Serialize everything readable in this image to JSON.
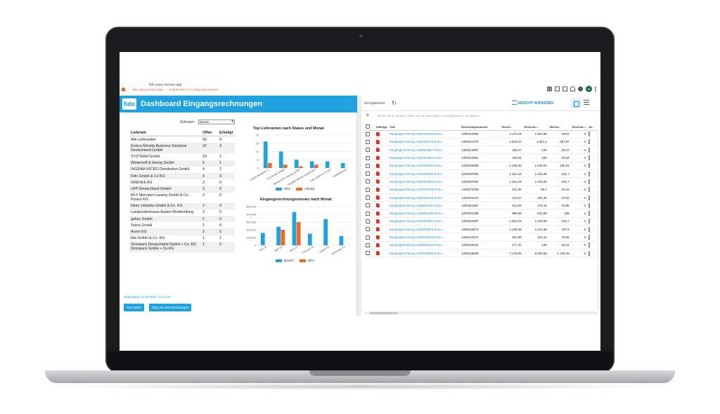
{
  "topbar": {
    "app_name": "fido easy invoice app",
    "breadcrumb": [
      "fido easy invoice app",
      "Ergebnisse in 4 eXtop documents"
    ]
  },
  "dashboard": {
    "logo": "fido",
    "title": "Dashboard Eingangsrechnungen",
    "zeitraum_label": "Zeitraum:",
    "zeitraum_value": "Monat",
    "table_headers": [
      "Lieferant",
      "Offen",
      "Erledigt"
    ],
    "rows": [
      {
        "name": "Alle Lieferanten",
        "offen": "60",
        "erledigt": "9"
      },
      {
        "name": "Konica Minolta Business Solutions Deutschland GmbH",
        "offen": "16",
        "erledigt": "3"
      },
      {
        "name": "SYSTEAM GmbH",
        "offen": "10",
        "erledigt": "2"
      },
      {
        "name": "Winterhoff & Hering GmbH",
        "offen": "5",
        "erledigt": "1"
      },
      {
        "name": "INGRAM MICRO Distribution GmbH",
        "offen": "4",
        "erledigt": "2"
      },
      {
        "name": "Fido GmbH & Co KG",
        "offen": "4",
        "erledigt": "0"
      },
      {
        "name": "GRENKE AG",
        "offen": "3",
        "erledigt": "0"
      },
      {
        "name": "UFP Deutschland GmbH",
        "offen": "3",
        "erledigt": "0"
      },
      {
        "name": "MLF Mercator-Leasing GmbH & Co. Finanz-KG",
        "offen": "3",
        "erledigt": "0"
      },
      {
        "name": "Heinr. Hünicke GmbH & Co. KG",
        "offen": "2",
        "erledigt": "0"
      },
      {
        "name": "Landesoberkasse Baden-Württemberg",
        "offen": "2",
        "erledigt": "0"
      },
      {
        "name": "gebos GmbH",
        "offen": "2",
        "erledigt": "0"
      },
      {
        "name": "Tekno GmbH",
        "offen": "2",
        "erledigt": "0"
      },
      {
        "name": "Auren KG",
        "offen": "2",
        "erledigt": "0"
      },
      {
        "name": "fido GmbH & Co. KG",
        "offen": "1",
        "erledigt": "1"
      },
      {
        "name": "Storopack Deutschland GmbH + Co. KG Storopack GmbH + Co.KG",
        "offen": "1",
        "erledigt": "0"
      }
    ],
    "datenstand": "Datenstand: 22.05.2024, 14:12:24",
    "btn_neu": "Neu laden",
    "btn_alle": "Zeig mir alle Rechnungen"
  },
  "chart_data": [
    {
      "type": "bar",
      "title": "Top Lieferanten nach Status und Monat",
      "categories": [
        "Konica Minolta Business S.",
        "SYSTEAM GmbH",
        "Winterhoff & Hering GmbH",
        "INGRAM MICRO Distribution",
        "Fido GmbH & Co KG",
        "GRENKE AG"
      ],
      "series": [
        {
          "name": "offen",
          "values": [
            16,
            10,
            5,
            4,
            4,
            3
          ],
          "color": "#1ea2e0"
        },
        {
          "name": "erledigt",
          "values": [
            3,
            2,
            1,
            2,
            0,
            0
          ],
          "color": "#f26a21"
        }
      ],
      "yticks": [
        "0",
        "5",
        "10",
        "15",
        "20"
      ],
      "ylim": [
        0,
        20
      ],
      "legend": "bottom"
    },
    {
      "type": "bar",
      "title": "Eingangsrechnungsumsatz nach Monat",
      "categories": [
        "Mai 24",
        "April 24",
        "März 24",
        "Februar 24",
        "Januar 24",
        "Dezember 23"
      ],
      "series": [
        {
          "name": "gesamt",
          "values": [
            160000,
            240000,
            430000,
            150000,
            340000,
            120000
          ],
          "color": "#1ea2e0"
        },
        {
          "name": "offen",
          "values": [
            0,
            200000,
            300000,
            0,
            0,
            0
          ],
          "color": "#f26a21"
        }
      ],
      "yticks": [
        "0",
        "100.000",
        "200.000",
        "300.000",
        "400.000",
        "500.000"
      ],
      "ylim": [
        0,
        500000
      ],
      "legend": "bottom"
    }
  ],
  "results": {
    "count_label": "16 Ergebnisse",
    "ansicht_label": "ANSICHT ANPASSEN",
    "group_hint": "Ziehen Sie die Spalten hierher, um die angezeigten Suchergebnisse zu gruppieren.",
    "headers": [
      "Dateityp",
      "Titel",
      "Rechnungsnummer",
      "Rechn...",
      "Rechnun...",
      "Mehrw...",
      "Rechnun...",
      "Ak..."
    ],
    "rows": [
      {
        "titel": "Eingangsrechnung 1200322056 Konic...",
        "nr": "1200322056",
        "a": "2.170,18",
        "b": "1.823,68",
        "c": "346,5",
        "d": "3"
      },
      {
        "titel": "Eingangsrechnung 1200321375 Konic...",
        "nr": "1200321375",
        "a": "1.615,07",
        "b": "1.357,2",
        "c": "257,87",
        "d": "3"
      },
      {
        "titel": "Eingangsrechnung 1200313867 Konic...",
        "nr": "1200313867",
        "a": "158,27",
        "b": "133",
        "c": "25,27",
        "d": "3"
      },
      {
        "titel": "Eingangsrechnung 1200312801 Konic...",
        "nr": "1200312801",
        "a": "185,64",
        "b": "156",
        "c": "29,64",
        "d": "3"
      },
      {
        "titel": "Eingangsrechnung 1200294569 Konic...",
        "nr": "1200294569",
        "a": "1.245,82",
        "b": "1.046,91",
        "c": "198,91",
        "d": "3"
      },
      {
        "titel": "Eingangsrechnung 1200287655 Konic...",
        "nr": "1200287655",
        "a": "1.451,18",
        "b": "1.219,48",
        "c": "231,7",
        "d": "3"
      },
      {
        "titel": "Eingangsrechnung 1200287654 Konic...",
        "nr": "1200287654",
        "a": "1.451,18",
        "b": "1.219,48",
        "c": "231,7",
        "d": "3"
      },
      {
        "titel": "Eingangsrechnung 1200272208 Konic...",
        "nr": "1200272208",
        "a": "101,39",
        "b": "85,2",
        "c": "16,19",
        "d": "3"
      },
      {
        "titel": "Eingangsrechnung 1200254410 Konic...",
        "nr": "1200254410",
        "a": "124,07",
        "b": "104,26",
        "c": "19,81",
        "d": "3"
      },
      {
        "titel": "Eingangsrechnung 1200261387 Konic...",
        "nr": "1200261387",
        "a": "212,00",
        "b": "178,15",
        "c": "33,85",
        "d": "3"
      },
      {
        "titel": "Eingangsrechnung 1200261288 Konic...",
        "nr": "1200261288",
        "a": "989,58",
        "b": "831,58",
        "c": "158",
        "d": "3"
      },
      {
        "titel": "Eingangsrechnung 1200254387 Konic...",
        "nr": "1200254387",
        "a": "1.451,18",
        "b": "1.219,48",
        "c": "231,7",
        "d": "3"
      },
      {
        "titel": "Eingangsrechnung 1200244673 Konic...",
        "nr": "1200244673",
        "a": "1.239,48",
        "b": "1.041,58",
        "c": "197,9",
        "d": "3"
      },
      {
        "titel": "Eingangsrechnung 1200244674 Konic...",
        "nr": "1200244674",
        "a": "491,96",
        "b": "413,41",
        "c": "78,55",
        "d": "3"
      },
      {
        "titel": "Eingangsrechnung 1200240610 Konic...",
        "nr": "1200240610",
        "a": "177,31",
        "b": "149",
        "c": "28,31",
        "d": "3"
      },
      {
        "titel": "Eingangsrechnung 1200233839 Konic...",
        "nr": "1200233839",
        "a": "7.143,05",
        "b": "6.002,56",
        "c": "1.140,49",
        "d": "3"
      }
    ]
  }
}
